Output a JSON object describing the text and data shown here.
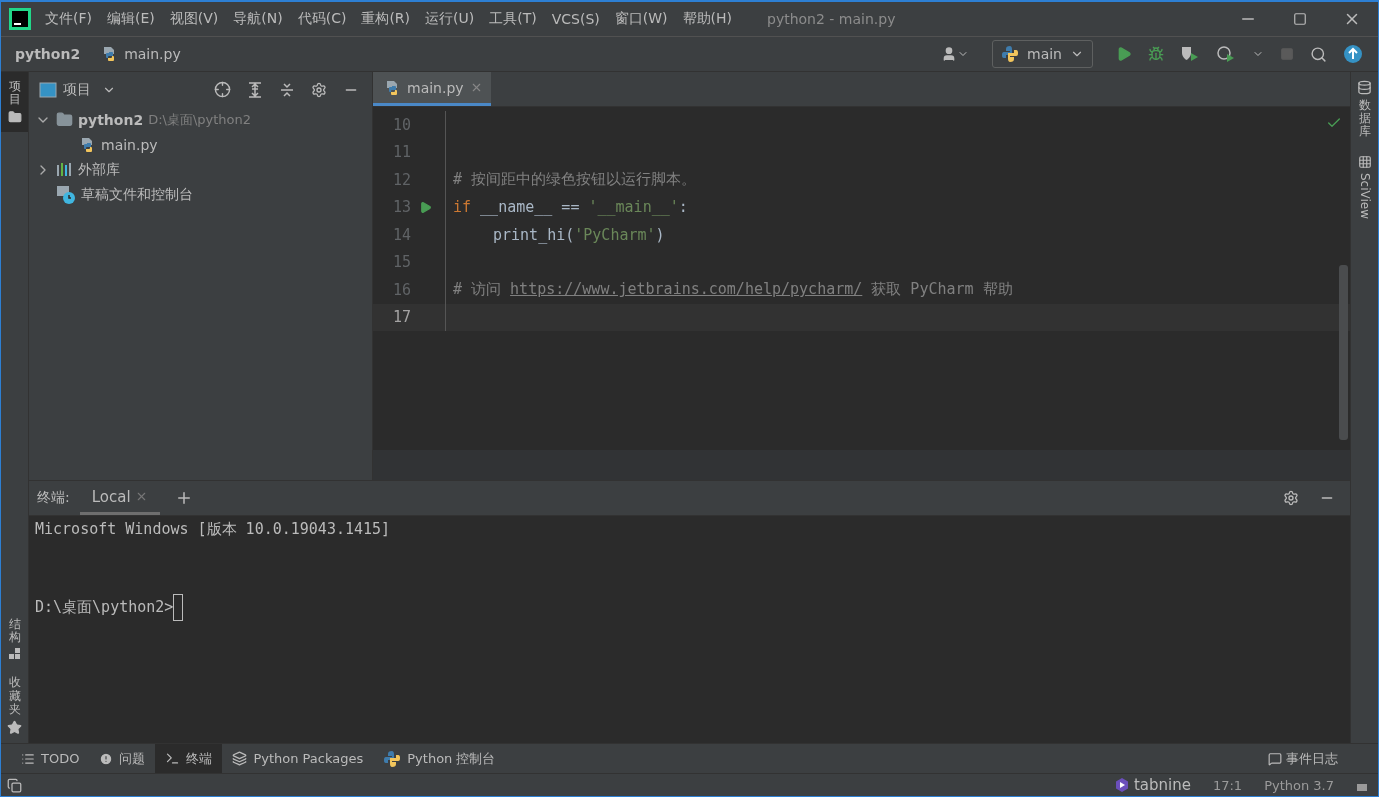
{
  "window": {
    "title": "python2 - main.py"
  },
  "menu": [
    {
      "label": "文件(F)"
    },
    {
      "label": "编辑(E)"
    },
    {
      "label": "视图(V)"
    },
    {
      "label": "导航(N)"
    },
    {
      "label": "代码(C)"
    },
    {
      "label": "重构(R)"
    },
    {
      "label": "运行(U)"
    },
    {
      "label": "工具(T)"
    },
    {
      "label": "VCS(S)"
    },
    {
      "label": "窗口(W)"
    },
    {
      "label": "帮助(H)"
    }
  ],
  "breadcrumb": [
    {
      "label": "python2",
      "kind": "project"
    },
    {
      "label": "main.py",
      "kind": "python-file"
    }
  ],
  "run_config": {
    "label": "main"
  },
  "left_strip": {
    "top": [
      {
        "label": "项目",
        "kind": "project",
        "selected": true
      }
    ],
    "bottom": [
      {
        "label": "结构",
        "kind": "structure",
        "selected": false
      },
      {
        "label": "收藏夹",
        "kind": "favorites",
        "selected": false
      }
    ]
  },
  "project_panel": {
    "title": "项目",
    "tree": [
      {
        "label": "python2",
        "path": "D:\\桌面\\python2",
        "kind": "folder",
        "expanded": true,
        "children": [
          {
            "label": "main.py",
            "kind": "python-file"
          }
        ]
      },
      {
        "label": "外部库",
        "kind": "library",
        "expanded": false
      },
      {
        "label": "草稿文件和控制台",
        "kind": "scratch"
      }
    ]
  },
  "editor": {
    "tabs": [
      {
        "label": "main.py",
        "selected": true
      }
    ],
    "lines": [
      {
        "number": "10",
        "current": false
      },
      {
        "number": "11",
        "current": false
      },
      {
        "number": "12",
        "current": false,
        "tokens": [
          {
            "text": "# 按间距中的绿色按钮以运行脚本。",
            "kind": "comment"
          }
        ]
      },
      {
        "number": "13",
        "current": false,
        "run_marker": true,
        "tokens": [
          {
            "text": "if",
            "kind": "keyword"
          },
          {
            "text": " __name__ == ",
            "kind": "plain"
          },
          {
            "text": "'__main__'",
            "kind": "string"
          },
          {
            "text": ":",
            "kind": "plain"
          }
        ]
      },
      {
        "number": "14",
        "current": false,
        "indented": true,
        "tokens": [
          {
            "text": "print_hi(",
            "kind": "plain"
          },
          {
            "text": "'PyCharm'",
            "kind": "string"
          },
          {
            "text": ")",
            "kind": "plain"
          }
        ]
      },
      {
        "number": "15",
        "current": false
      },
      {
        "number": "16",
        "current": false,
        "tokens": [
          {
            "text": "# 访问 ",
            "kind": "comment"
          },
          {
            "text": "https://www.jetbrains.com/help/pycharm/",
            "kind": "link"
          },
          {
            "text": " 获取 PyCharm 帮助",
            "kind": "comment"
          }
        ]
      },
      {
        "number": "17",
        "current": true
      }
    ]
  },
  "terminal": {
    "title": "终端:",
    "tabs": [
      {
        "label": "Local",
        "selected": true
      }
    ],
    "lines": [
      {
        "text": "Microsoft Windows [版本 10.0.19043.1415]",
        "kind": "output"
      },
      {
        "text": "D:\\桌面\\python2>",
        "kind": "prompt"
      }
    ]
  },
  "bottom_tabs": [
    {
      "label": "TODO",
      "kind": "todo",
      "selected": false
    },
    {
      "label": "问题",
      "kind": "problems",
      "selected": false
    },
    {
      "label": "终端",
      "kind": "terminal",
      "selected": true
    },
    {
      "label": "Python Packages",
      "kind": "packages",
      "selected": false
    },
    {
      "label": "Python 控制台",
      "kind": "console",
      "selected": false
    }
  ],
  "event_log": {
    "label": "事件日志"
  },
  "status_bar": {
    "plugin": "tabnine",
    "position": "17:1",
    "interpreter": "Python 3.7"
  },
  "right_strip": [
    {
      "label": "数据库",
      "kind": "database"
    },
    {
      "label": "SciView",
      "kind": "sciview"
    }
  ]
}
